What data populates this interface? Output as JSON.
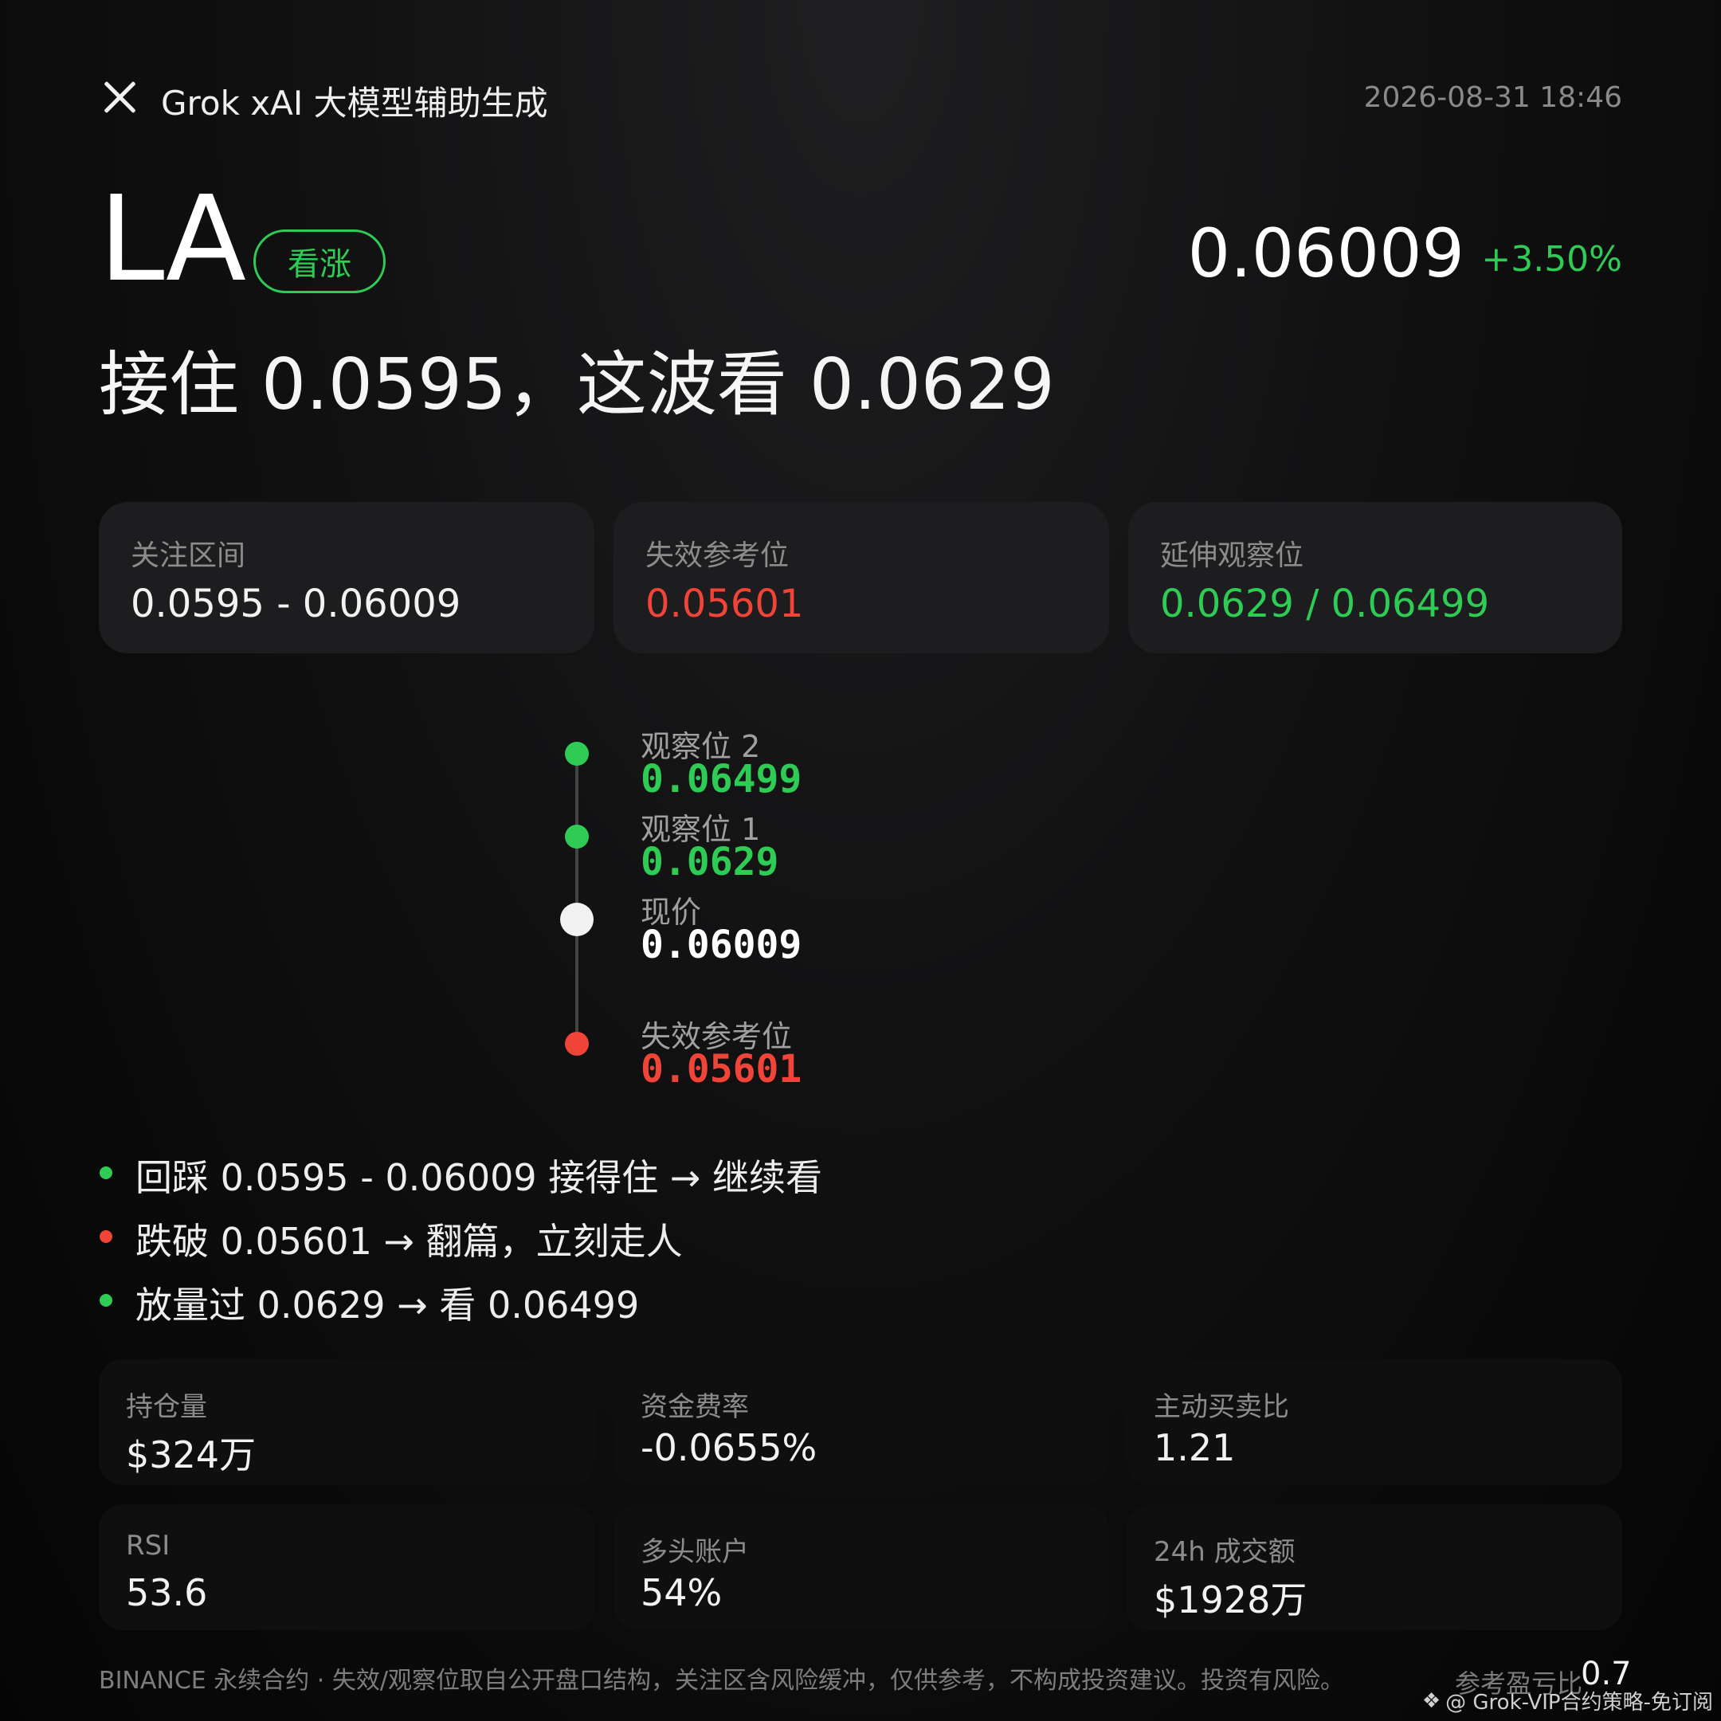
{
  "header": {
    "title": "Grok xAI 大模型辅助生成",
    "timestamp": "2026-08-31 18:46"
  },
  "hero": {
    "symbol": "LA",
    "bias": "看涨",
    "price": "0.06009",
    "change": "+3.50%",
    "headline": "接住 0.0595，这波看 0.0629"
  },
  "levels": [
    {
      "label": "关注区间",
      "value": "0.0595 - 0.06009"
    },
    {
      "label": "失效参考位",
      "value": "0.05601"
    },
    {
      "label": "延伸观察位",
      "value": "0.0629 / 0.06499"
    }
  ],
  "ladder": [
    {
      "label": "观察位 2",
      "value": "0.06499"
    },
    {
      "label": "观察位 1",
      "value": "0.0629"
    },
    {
      "label": "现价",
      "value": "0.06009"
    },
    {
      "label": "失效参考位",
      "value": "0.05601"
    }
  ],
  "scenarios": [
    "回踩 0.0595 - 0.06009 接得住 → 继续看",
    "跌破 0.05601 → 翻篇，立刻走人",
    "放量过 0.0629 → 看 0.06499"
  ],
  "stats": [
    {
      "label": "持仓量",
      "value": "$324万"
    },
    {
      "label": "资金费率",
      "value": "-0.0655%"
    },
    {
      "label": "主动买卖比",
      "value": "1.21"
    },
    {
      "label": "RSI",
      "value": "53.6"
    },
    {
      "label": "多头账户",
      "value": "54%"
    },
    {
      "label": "24h 成交额",
      "value": "$1928万"
    }
  ],
  "footer": {
    "note": "BINANCE 永续合约 · 失效/观察位取自公开盘口结构，关注区含风险缓冲，仅供参考，不构成投资建议。投资有风险。",
    "rr_label": "参考盈亏比",
    "rr_value": "0.7",
    "watermark": "@ Grok-VIP合约策略-免订阅"
  },
  "colors": {
    "bull": "#2ecc55",
    "bear": "#f04438",
    "current": "#f2f2f2"
  }
}
